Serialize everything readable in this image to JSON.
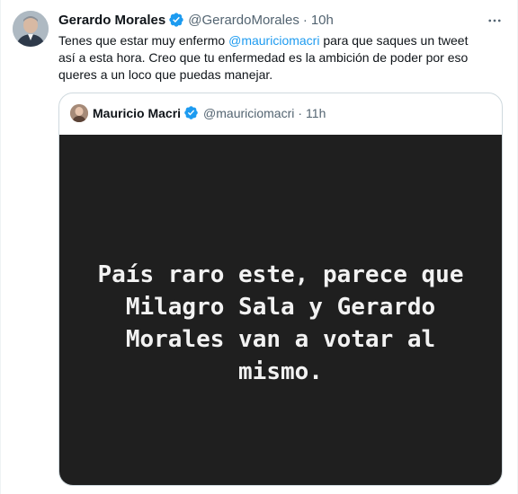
{
  "tweet": {
    "author_name": "Gerardo Morales",
    "author_handle": "@GerardoMorales",
    "separator": "·",
    "time": "10h",
    "text_before": "Tenes que estar muy enfermo ",
    "mention": "@mauriciomacri",
    "text_after": " para que saques un tweet\nasí a esta hora. Creo que tu enfermedad es la ambición de poder por eso\nqueres a un loco que puedas manejar.",
    "more_icon": "more-horizontal-icon",
    "verified_icon": "verified-badge-icon"
  },
  "quoted": {
    "author_name": "Mauricio Macri",
    "author_handle": "@mauriciomacri",
    "separator": "·",
    "time": "11h",
    "media_text": "País raro este, parece que Milagro Sala y Gerardo Morales van a votar al mismo.",
    "verified_icon": "verified-badge-icon"
  },
  "colors": {
    "link": "#1d9bf0",
    "secondary_text": "#536471",
    "border": "#cfd9de",
    "media_bg": "#1f1f1f",
    "media_text": "#f2f2f2"
  }
}
